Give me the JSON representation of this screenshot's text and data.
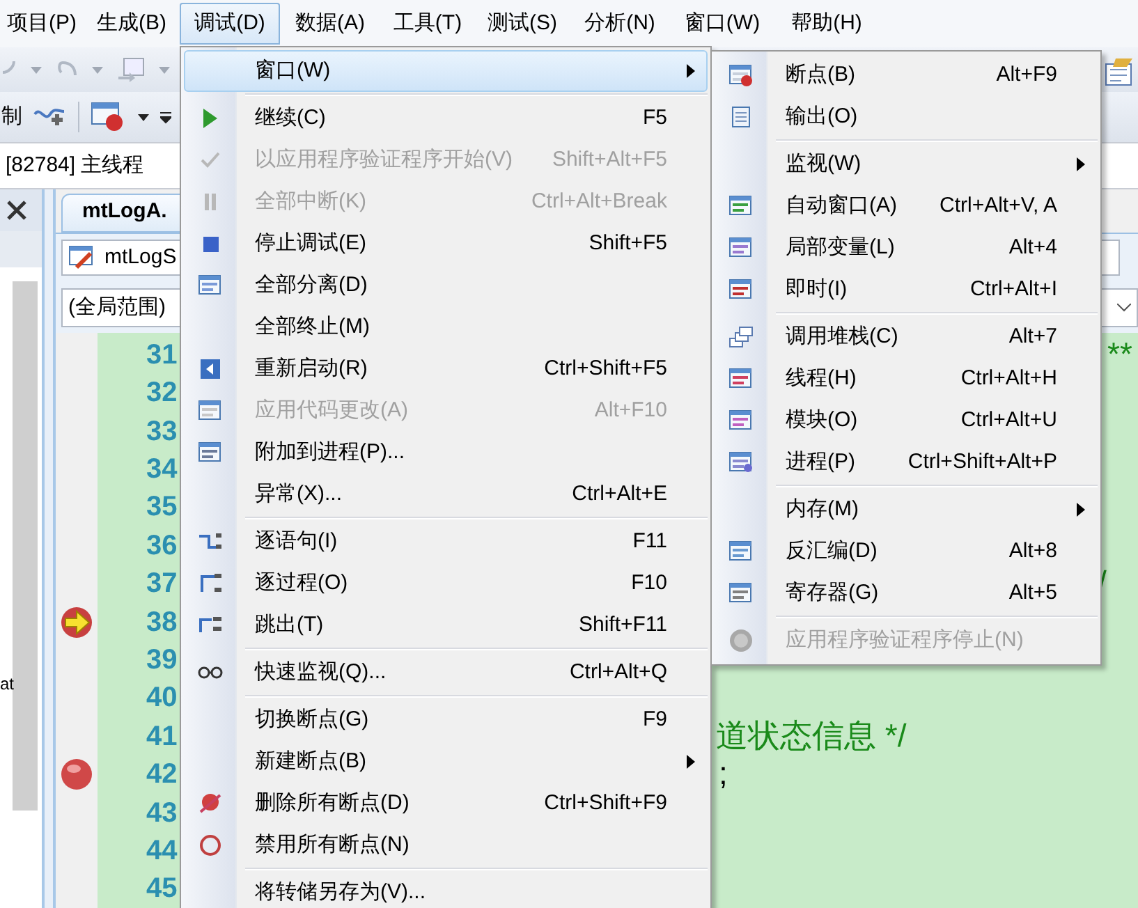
{
  "menubar": [
    {
      "label": "项目(P)",
      "selected": false
    },
    {
      "label": "生成(B)",
      "selected": false
    },
    {
      "label": "调试(D)",
      "selected": true
    },
    {
      "label": "数据(A)",
      "selected": false
    },
    {
      "label": "工具(T)",
      "selected": false
    },
    {
      "label": "测试(S)",
      "selected": false
    },
    {
      "label": "分析(N)",
      "selected": false
    },
    {
      "label": "窗口(W)",
      "selected": false
    },
    {
      "label": "帮助(H)",
      "selected": false
    }
  ],
  "toolbar": {
    "label": "制"
  },
  "thread": "[82784] 主线程",
  "side_panel": {
    "text": "at"
  },
  "editor": {
    "tab": "mtLogA.",
    "type_box": "mtLogS",
    "scope": "(全局范围)",
    "lines": [
      {
        "kind": "plain",
        "number": "31",
        "code": "**"
      },
      {
        "kind": "plain",
        "number": "32"
      },
      {
        "kind": "plain",
        "number": "33"
      },
      {
        "kind": "plain",
        "number": "34"
      },
      {
        "kind": "plain",
        "number": "35"
      },
      {
        "kind": "plain",
        "number": "36"
      },
      {
        "kind": "plain",
        "number": "37",
        "code": "/"
      },
      {
        "kind": "current",
        "number": "38"
      },
      {
        "kind": "plain",
        "number": "39"
      },
      {
        "kind": "plain",
        "number": "40"
      },
      {
        "kind": "plain",
        "number": "41",
        "code": "道状态信息 */"
      },
      {
        "kind": "breakpoint",
        "number": "42",
        "code": ";"
      },
      {
        "kind": "plain",
        "number": "43"
      },
      {
        "kind": "plain",
        "number": "44"
      },
      {
        "kind": "plain",
        "number": "45"
      }
    ]
  },
  "debug_menu": [
    {
      "kind": "item",
      "label": "窗口(W)",
      "submenu": true,
      "selected": true,
      "disabled": false
    },
    {
      "kind": "separator"
    },
    {
      "kind": "item",
      "label": "继续(C)",
      "shortcut": "F5",
      "selected": false,
      "disabled": false
    },
    {
      "kind": "item",
      "label": "以应用程序验证程序开始(V)",
      "shortcut": "Shift+Alt+F5",
      "selected": false,
      "disabled": true
    },
    {
      "kind": "item",
      "label": "全部中断(K)",
      "shortcut": "Ctrl+Alt+Break",
      "selected": false,
      "disabled": true
    },
    {
      "kind": "item",
      "label": "停止调试(E)",
      "shortcut": "Shift+F5",
      "selected": false,
      "disabled": false
    },
    {
      "kind": "item",
      "label": "全部分离(D)",
      "selected": false,
      "disabled": false
    },
    {
      "kind": "item",
      "label": "全部终止(M)",
      "selected": false,
      "disabled": false
    },
    {
      "kind": "item",
      "label": "重新启动(R)",
      "shortcut": "Ctrl+Shift+F5",
      "selected": false,
      "disabled": false
    },
    {
      "kind": "item",
      "label": "应用代码更改(A)",
      "shortcut": "Alt+F10",
      "selected": false,
      "disabled": true
    },
    {
      "kind": "item",
      "label": "附加到进程(P)...",
      "selected": false,
      "disabled": false
    },
    {
      "kind": "item",
      "label": "异常(X)...",
      "shortcut": "Ctrl+Alt+E",
      "selected": false,
      "disabled": false
    },
    {
      "kind": "separator"
    },
    {
      "kind": "item",
      "label": "逐语句(I)",
      "shortcut": "F11",
      "selected": false,
      "disabled": false
    },
    {
      "kind": "item",
      "label": "逐过程(O)",
      "shortcut": "F10",
      "selected": false,
      "disabled": false
    },
    {
      "kind": "item",
      "label": "跳出(T)",
      "shortcut": "Shift+F11",
      "selected": false,
      "disabled": false
    },
    {
      "kind": "separator"
    },
    {
      "kind": "item",
      "label": "快速监视(Q)...",
      "shortcut": "Ctrl+Alt+Q",
      "selected": false,
      "disabled": false
    },
    {
      "kind": "separator"
    },
    {
      "kind": "item",
      "label": "切换断点(G)",
      "shortcut": "F9",
      "selected": false,
      "disabled": false
    },
    {
      "kind": "item",
      "label": "新建断点(B)",
      "submenu": true,
      "selected": false,
      "disabled": false
    },
    {
      "kind": "item",
      "label": "删除所有断点(D)",
      "shortcut": "Ctrl+Shift+F9",
      "selected": false,
      "disabled": false
    },
    {
      "kind": "item",
      "label": "禁用所有断点(N)",
      "selected": false,
      "disabled": false
    },
    {
      "kind": "separator"
    },
    {
      "kind": "item",
      "label": "将转储另存为(V)...",
      "selected": false,
      "disabled": false
    }
  ],
  "window_submenu": [
    {
      "kind": "item",
      "label": "断点(B)",
      "shortcut": "Alt+F9",
      "disabled": false
    },
    {
      "kind": "item",
      "label": "输出(O)",
      "disabled": false
    },
    {
      "kind": "separator"
    },
    {
      "kind": "item",
      "label": "监视(W)",
      "submenu": true,
      "disabled": false
    },
    {
      "kind": "item",
      "label": "自动窗口(A)",
      "shortcut": "Ctrl+Alt+V, A",
      "disabled": false
    },
    {
      "kind": "item",
      "label": "局部变量(L)",
      "shortcut": "Alt+4",
      "disabled": false
    },
    {
      "kind": "item",
      "label": "即时(I)",
      "shortcut": "Ctrl+Alt+I",
      "disabled": false
    },
    {
      "kind": "separator"
    },
    {
      "kind": "item",
      "label": "调用堆栈(C)",
      "shortcut": "Alt+7",
      "disabled": false
    },
    {
      "kind": "item",
      "label": "线程(H)",
      "shortcut": "Ctrl+Alt+H",
      "disabled": false
    },
    {
      "kind": "item",
      "label": "模块(O)",
      "shortcut": "Ctrl+Alt+U",
      "disabled": false
    },
    {
      "kind": "item",
      "label": "进程(P)",
      "shortcut": "Ctrl+Shift+Alt+P",
      "disabled": false
    },
    {
      "kind": "separator"
    },
    {
      "kind": "item",
      "label": "内存(M)",
      "submenu": true,
      "disabled": false
    },
    {
      "kind": "item",
      "label": "反汇编(D)",
      "shortcut": "Alt+8",
      "disabled": false
    },
    {
      "kind": "item",
      "label": "寄存器(G)",
      "shortcut": "Alt+5",
      "disabled": false
    },
    {
      "kind": "separator"
    },
    {
      "kind": "item",
      "label": "应用程序验证程序停止(N)",
      "disabled": true
    }
  ]
}
